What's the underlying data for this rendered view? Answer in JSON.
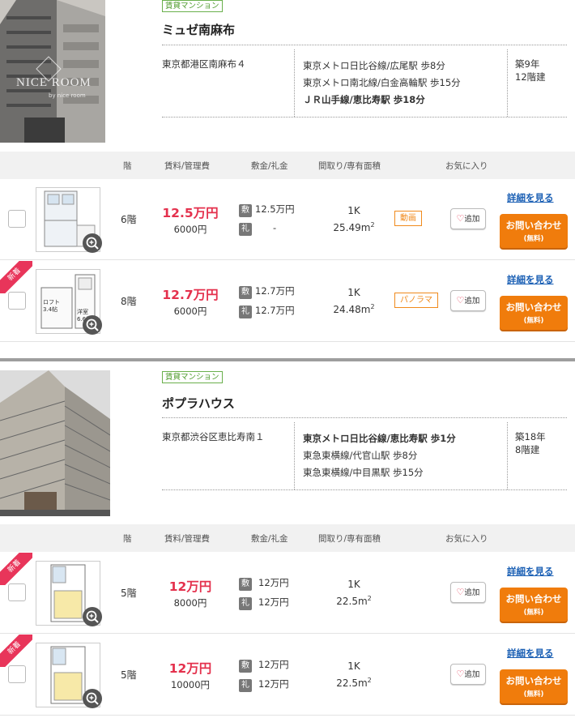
{
  "table_headers": {
    "floor": "階",
    "rent": "賃料/管理費",
    "deposit": "敷金/礼金",
    "layout": "間取り/専有面積",
    "favorite": "お気に入り"
  },
  "labels": {
    "shiki": "敷",
    "rei": "礼",
    "fav": "追加",
    "detail": "詳細を見る",
    "inquiry": "お問い合わせ",
    "inquiry_sub": "(無料)",
    "new": "新着"
  },
  "buildings": [
    {
      "type": "賃貸マンション",
      "name": "ミュゼ南麻布",
      "address": "東京都港区南麻布４",
      "access": [
        "東京メトロ日比谷線/広尾駅 歩8分",
        "東京メトロ南北線/白金高輪駅 歩15分",
        "ＪＲ山手線/恵比寿駅 歩18分"
      ],
      "age": "築9年",
      "floors": "12階建",
      "photo_watermark": "NICE ROOM",
      "photo_watermark_sub": "by nice room",
      "rooms": [
        {
          "new": false,
          "floor": "6階",
          "rent": "12.5万円",
          "fee": "6000円",
          "deposit": "12.5万円",
          "key_money": "-",
          "layout": "1K",
          "area": "25.49m",
          "area_unit": "2",
          "media": "動画"
        },
        {
          "new": true,
          "floor": "8階",
          "rent": "12.7万円",
          "fee": "6000円",
          "deposit": "12.7万円",
          "key_money": "12.7万円",
          "layout": "1K",
          "area": "24.48m",
          "area_unit": "2",
          "media": "パノラマ",
          "plan_text_1": "ロフト 3.4帖",
          "plan_text_2": "洋室 6.6帖"
        }
      ]
    },
    {
      "type": "賃貸マンション",
      "name": "ポプラハウス",
      "address": "東京都渋谷区恵比寿南１",
      "access": [
        "東京メトロ日比谷線/恵比寿駅 歩1分",
        "東急東横線/代官山駅 歩8分",
        "東急東横線/中目黒駅 歩15分"
      ],
      "age": "築18年",
      "floors": "8階建",
      "rooms": [
        {
          "new": true,
          "floor": "5階",
          "rent": "12万円",
          "fee": "8000円",
          "deposit": "12万円",
          "key_money": "12万円",
          "layout": "1K",
          "area": "22.5m",
          "area_unit": "2",
          "media": ""
        },
        {
          "new": true,
          "floor": "5階",
          "rent": "12万円",
          "fee": "10000円",
          "deposit": "12万円",
          "key_money": "12万円",
          "layout": "1K",
          "area": "22.5m",
          "area_unit": "2",
          "media": ""
        }
      ]
    }
  ],
  "colors": {
    "price": "#e4314d",
    "button": "#f07c0c",
    "link": "#1a5fb4",
    "type_badge": "#6ab04c",
    "new_band": "#e8355a",
    "media_badge": "#f08a1c"
  }
}
